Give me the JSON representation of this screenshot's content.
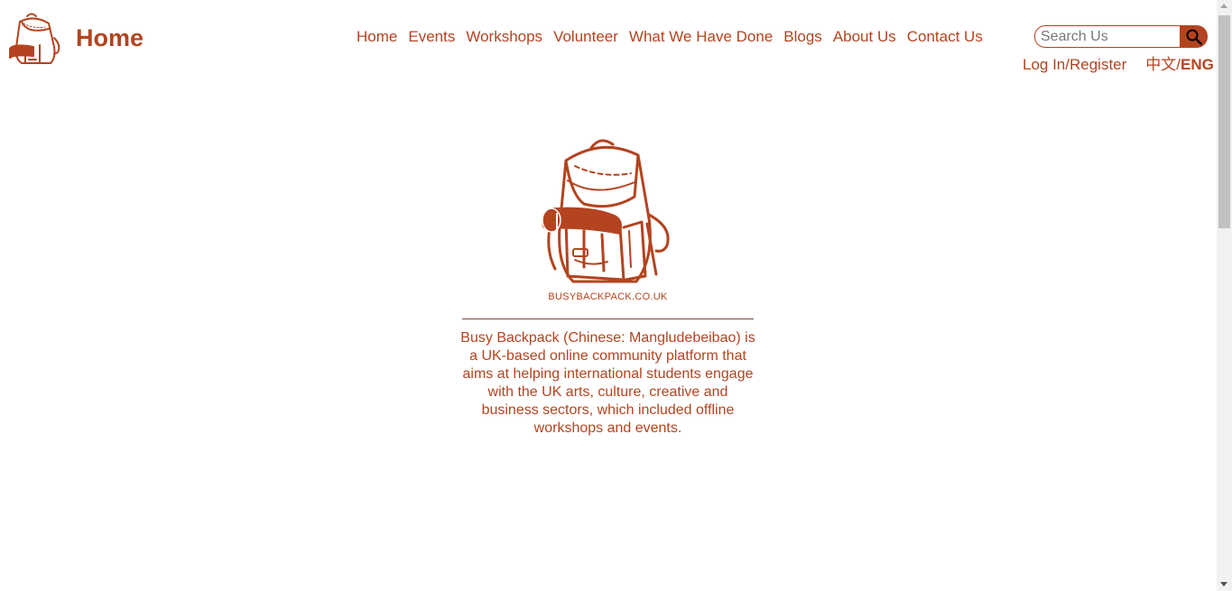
{
  "header": {
    "title": "Home",
    "nav": [
      {
        "label": "Home"
      },
      {
        "label": "Events"
      },
      {
        "label": "Workshops"
      },
      {
        "label": "Volunteer"
      },
      {
        "label": "What We Have Done"
      },
      {
        "label": "Blogs"
      },
      {
        "label": "About Us"
      },
      {
        "label": "Contact Us"
      }
    ],
    "search": {
      "placeholder": "Search Us",
      "value": ""
    },
    "login_label": "Log In/Register",
    "lang": {
      "zh": "中文",
      "separator": "/",
      "en": "ENG"
    }
  },
  "hero": {
    "caption": "BUSYBACKPACK.CO.UK",
    "description": "Busy Backpack (Chinese: Mangludebeibao) is a UK-based online community platform that aims at helping international students engage with the UK arts, culture, creative and business sectors, which included offline workshops and events."
  },
  "icons": {
    "logo": "backpack-logo-icon",
    "search": "search-icon"
  },
  "colors": {
    "brand": "#b3441f",
    "background": "#ffffff"
  }
}
